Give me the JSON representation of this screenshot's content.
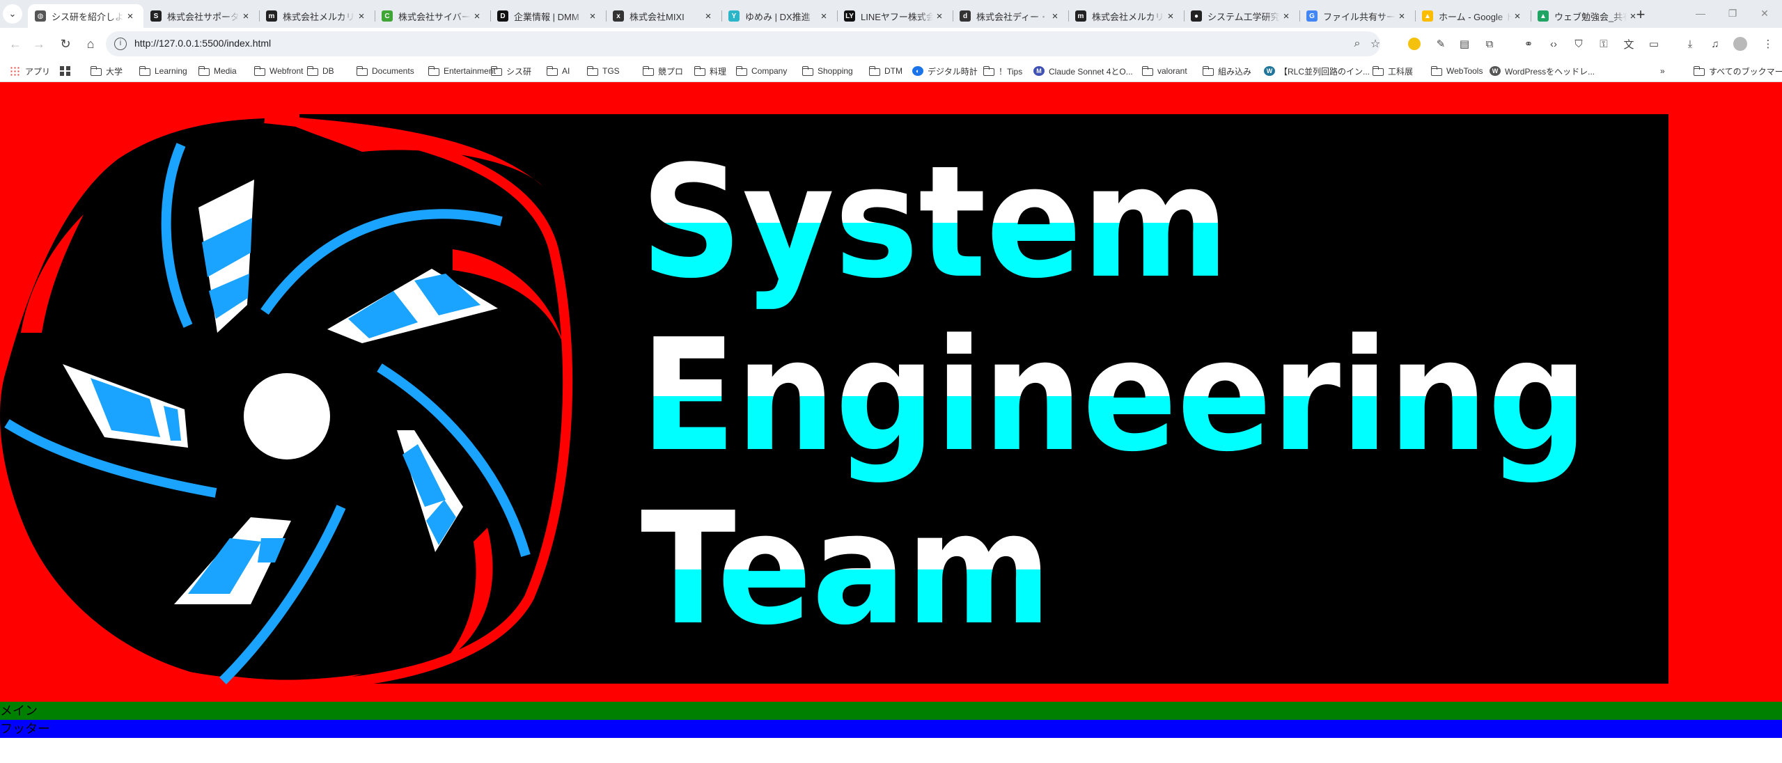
{
  "browser": {
    "tabs": [
      {
        "title": "シス研を紹介しよう",
        "favicon": "globe-icon",
        "fav_color": "#555555",
        "fav_char": "◍",
        "active": true
      },
      {
        "title": "株式会社サポーターズ",
        "favicon": "supporterz-icon",
        "fav_color": "#222222",
        "fav_char": "S",
        "active": false
      },
      {
        "title": "株式会社メルカリ",
        "favicon": "m-icon",
        "fav_color": "#222222",
        "fav_char": "m",
        "active": false
      },
      {
        "title": "株式会社サイバーエージェント",
        "favicon": "cyberagent-icon",
        "fav_color": "#3fa535",
        "fav_char": "C",
        "active": false
      },
      {
        "title": "企業情報 | DMM",
        "favicon": "dmm-icon",
        "fav_color": "#111111",
        "fav_char": "D",
        "active": false
      },
      {
        "title": "株式会社MIXI",
        "favicon": "mixi-icon",
        "fav_color": "#333333",
        "fav_char": "x",
        "active": false
      },
      {
        "title": "ゆめみ | DX推進",
        "favicon": "yumemi-icon",
        "fav_color": "#2bb5c9",
        "fav_char": "Y",
        "active": false
      },
      {
        "title": "LINEヤフー株式会社",
        "favicon": "ly-icon",
        "fav_color": "#111111",
        "fav_char": "LY",
        "active": false
      },
      {
        "title": "株式会社ディー・エヌ・エー",
        "favicon": "dena-icon",
        "fav_color": "#333333",
        "fav_char": "d",
        "active": false
      },
      {
        "title": "株式会社メルカリ",
        "favicon": "m-icon",
        "fav_color": "#222222",
        "fav_char": "m",
        "active": false
      },
      {
        "title": "システム工学研究会",
        "favicon": "syskenn-icon",
        "fav_color": "#222222",
        "fav_char": "●",
        "active": false
      },
      {
        "title": "ファイル共有サービス",
        "favicon": "google-icon",
        "fav_color": "#4285f4",
        "fav_char": "G",
        "active": false
      },
      {
        "title": "ホーム - Google ドライブ",
        "favicon": "drive-icon",
        "fav_color": "#fbbc04",
        "fav_char": "▲",
        "active": false
      },
      {
        "title": "ウェブ勉強会_共有",
        "favicon": "drive-icon",
        "fav_color": "#1fa463",
        "fav_char": "▲",
        "active": false
      }
    ],
    "url": "http://127.0.0.1:5500/index.html",
    "bookmarks": [
      {
        "label": "アプリ",
        "type": "apps"
      },
      {
        "label": "",
        "type": "grid"
      },
      {
        "label": "大学",
        "type": "folder"
      },
      {
        "label": "Learning",
        "type": "folder"
      },
      {
        "label": "Media",
        "type": "folder"
      },
      {
        "label": "Webfront",
        "type": "folder"
      },
      {
        "label": "DB",
        "type": "folder"
      },
      {
        "label": "Documents",
        "type": "folder"
      },
      {
        "label": "Entertainment",
        "type": "folder"
      },
      {
        "label": "シス研",
        "type": "folder"
      },
      {
        "label": "AI",
        "type": "folder"
      },
      {
        "label": "TGS",
        "type": "folder"
      },
      {
        "label": "競プロ",
        "type": "folder"
      },
      {
        "label": "料理",
        "type": "folder"
      },
      {
        "label": "Company",
        "type": "folder"
      },
      {
        "label": "Shopping",
        "type": "folder"
      },
      {
        "label": "DTM",
        "type": "folder"
      },
      {
        "label": "デジタル時計",
        "type": "site"
      },
      {
        "label": "！Tips",
        "type": "folder"
      },
      {
        "label": "Claude Sonnet 4とO...",
        "type": "site-m"
      },
      {
        "label": "valorant",
        "type": "folder"
      },
      {
        "label": "組み込み",
        "type": "folder"
      },
      {
        "label": "【RLC並列回路のイン...",
        "type": "site-wp"
      },
      {
        "label": "工科展",
        "type": "folder"
      },
      {
        "label": "WebTools",
        "type": "folder"
      },
      {
        "label": "WordPressをヘッドレ...",
        "type": "site-w"
      }
    ],
    "all_bookmarks": "すべてのブックマーク"
  },
  "page": {
    "logo_words": [
      "System",
      "Engineering",
      "Team"
    ],
    "main_label": "メイン",
    "footer_label": "フッター",
    "colors": {
      "header_bg": "#ff0000",
      "logo_bg": "#000000",
      "accent_cyan": "#00ffff",
      "blade_blue": "#1aa3ff",
      "main_bg": "#008000",
      "footer_bg": "#0000ff"
    }
  }
}
